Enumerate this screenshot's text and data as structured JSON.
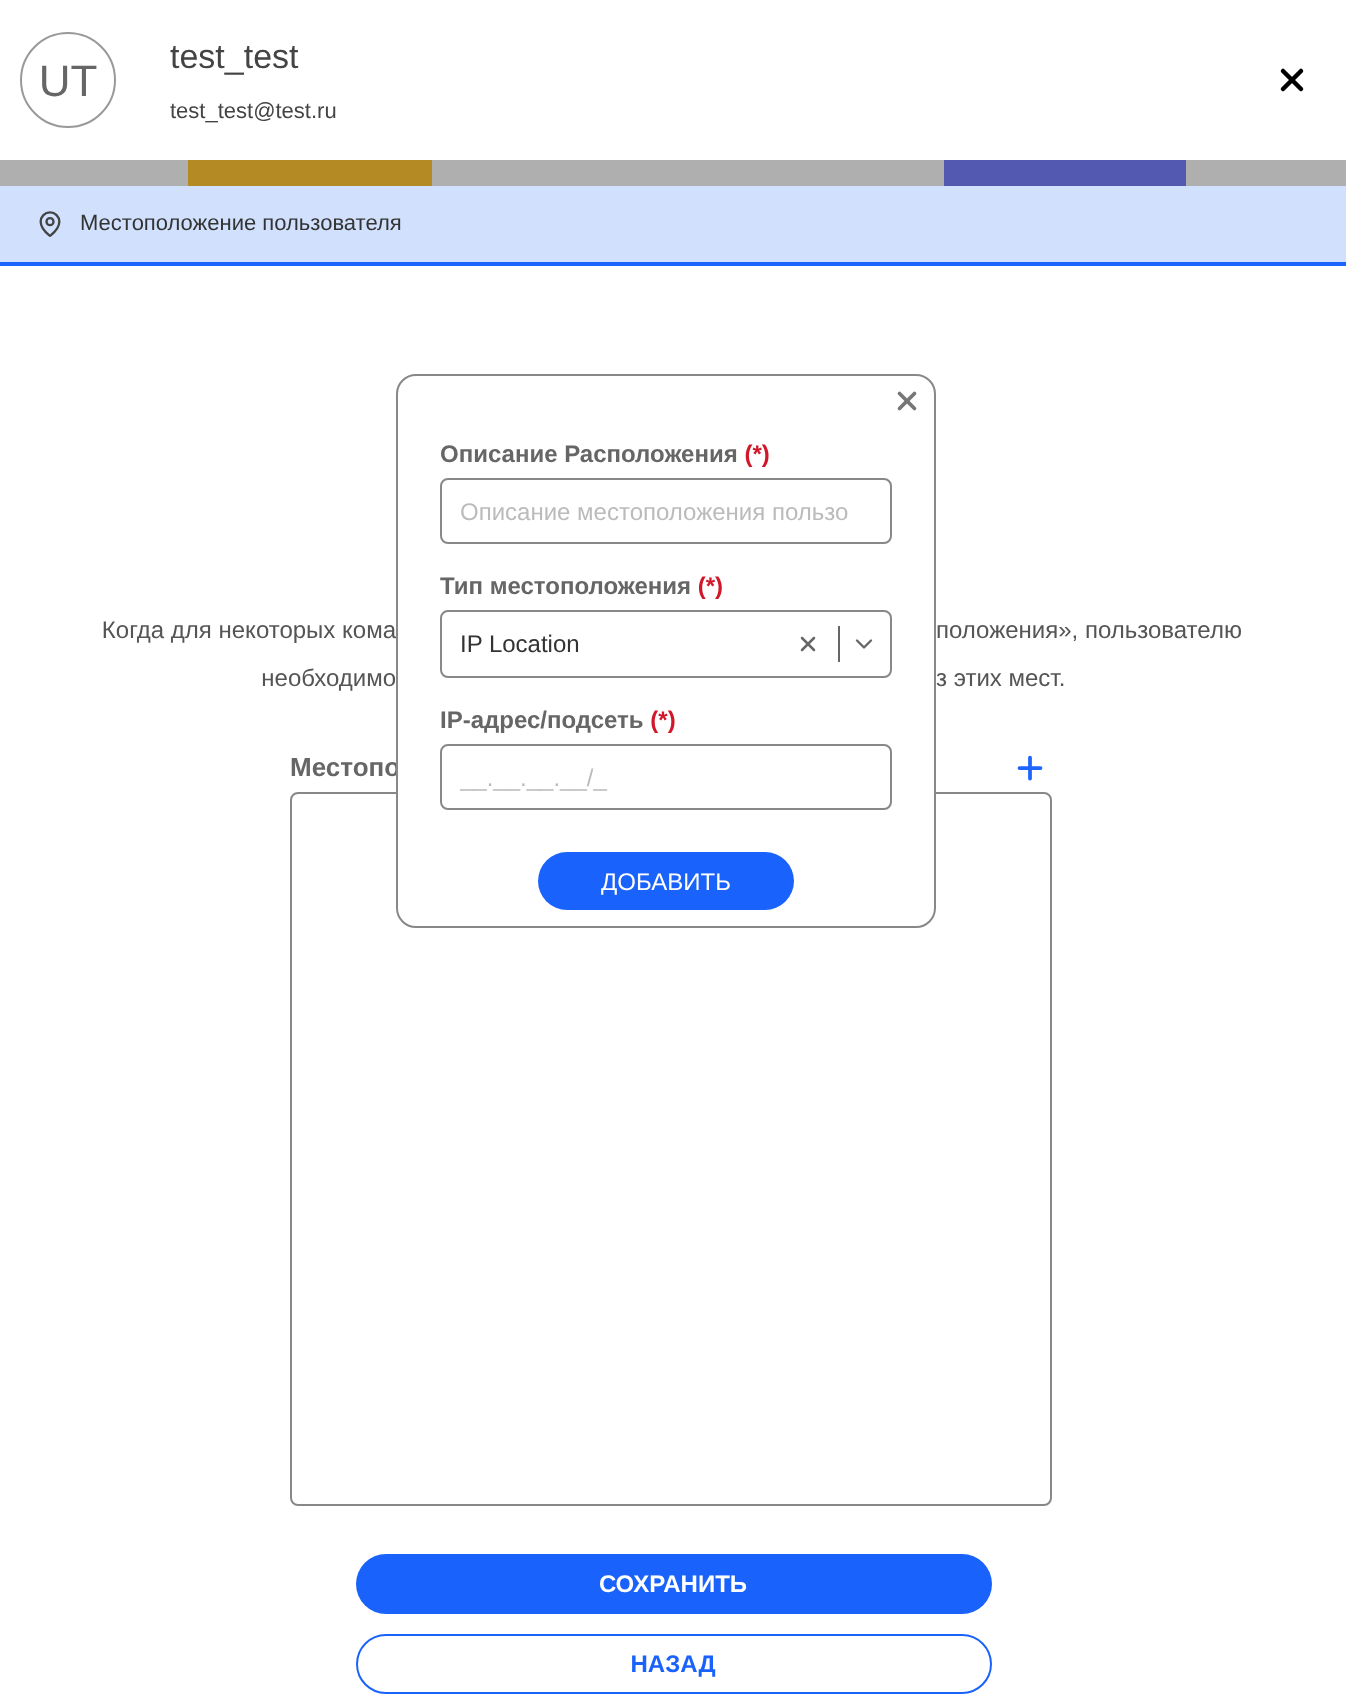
{
  "user": {
    "initials": "UT",
    "name": "test_test",
    "email": "test_test@test.ru"
  },
  "section": {
    "title": "Местоположение пользователя"
  },
  "description": {
    "line_1_left": "Когда для некоторых кома",
    "line_1_right": "положения», пользователю",
    "line_2_left": "необходимо",
    "line_2_right": "з этих мест."
  },
  "locations": {
    "label": "Местопо"
  },
  "buttons": {
    "save": "СОХРАНИТЬ",
    "back": "НАЗАД"
  },
  "dialog": {
    "fields": [
      {
        "kind": "text",
        "label": "Описание Расположения",
        "required": "(*)",
        "placeholder": "Описание местоположения пользо"
      },
      {
        "kind": "select",
        "label": "Тип местоположения",
        "required": "(*)",
        "value": "IP Location"
      },
      {
        "kind": "text",
        "label": "IP-адрес/подсеть",
        "required": "(*)",
        "placeholder": "__.__.__.__/_"
      }
    ],
    "submit": "ДОБАВИТЬ"
  }
}
